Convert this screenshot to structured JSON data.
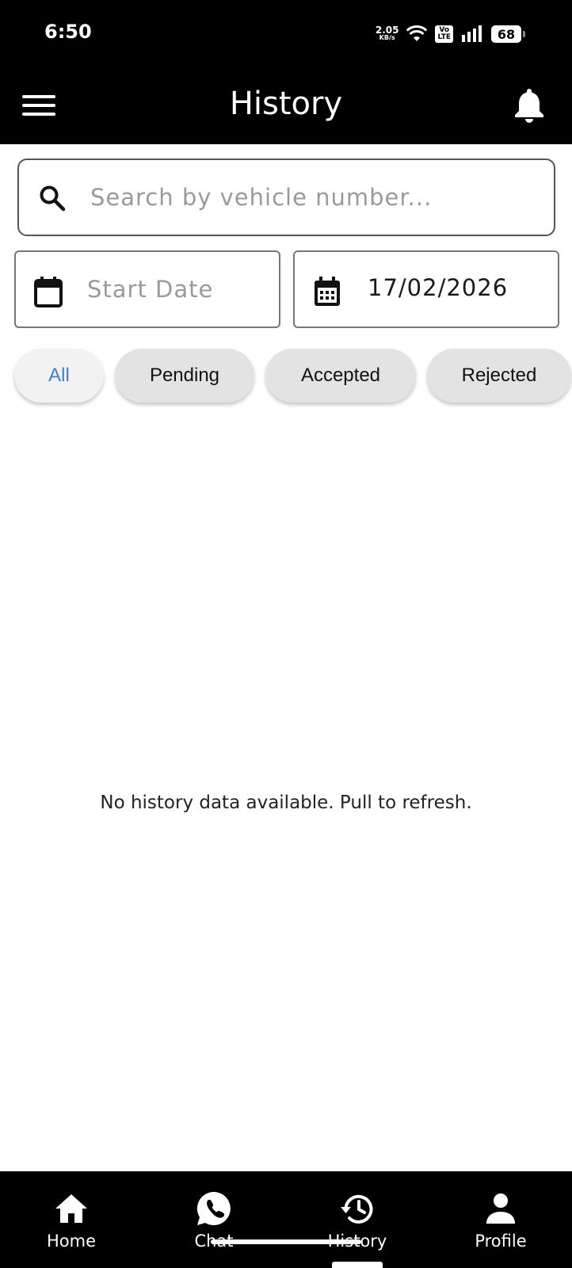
{
  "status_bar": {
    "time": "6:50",
    "net_speed_value": "2.05",
    "net_speed_unit": "KB/s",
    "volte_top": "Vo",
    "volte_bottom": "LTE",
    "battery": "68",
    "icons": [
      "wifi-icon",
      "signal-icon",
      "battery-icon"
    ]
  },
  "app_bar": {
    "title": "History",
    "left_icon": "menu-icon",
    "right_icon": "bell-icon"
  },
  "search": {
    "placeholder": "Search by vehicle number...",
    "value": "",
    "icon": "search-icon"
  },
  "dates": {
    "start_placeholder": "Start Date",
    "end_value": "17/02/2026"
  },
  "filters": {
    "selected": "All",
    "items": [
      {
        "label": "All"
      },
      {
        "label": "Pending"
      },
      {
        "label": "Accepted"
      },
      {
        "label": "Rejected"
      }
    ]
  },
  "empty_state": {
    "message": "No history data available. Pull to refresh."
  },
  "bottom_nav": {
    "active": "History",
    "items": [
      {
        "label": "Home",
        "icon": "home-icon"
      },
      {
        "label": "Chat",
        "icon": "whatsapp-chat-icon"
      },
      {
        "label": "History",
        "icon": "history-icon"
      },
      {
        "label": "Profile",
        "icon": "person-icon"
      }
    ]
  },
  "colors": {
    "bar_background": "#000000",
    "accent": "#3b7fd9",
    "chip_background": "#e3e3e3"
  }
}
